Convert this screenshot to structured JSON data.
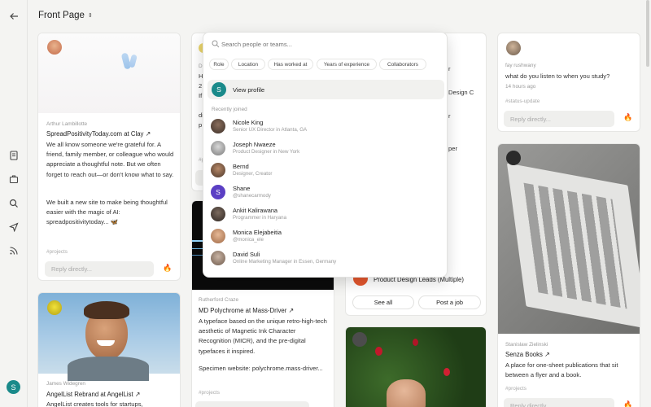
{
  "header": {
    "title": "Front Page",
    "switcher_glyph": "⇕"
  },
  "rail": {
    "icons": [
      "back-arrow-icon",
      "notebook-icon",
      "briefcase-icon",
      "search-icon",
      "send-icon",
      "rss-icon"
    ],
    "avatar_initial": "S"
  },
  "colors": {
    "teal": "#1a8a8a",
    "purple": "#5b3fc4",
    "orange": "#e4572e",
    "fire": "#e8751a"
  },
  "card1": {
    "author": "Arthur Lambillotte",
    "title": "SpreadPositivityToday.com at Clay ↗",
    "body1": "We all know someone we're grateful for. A friend, family member, or colleague who would appreciate a thoughtful note. But we often forget to reach out—or don't know what to say.",
    "body2": "We built a new site to make being thoughtful easier with the magic of AI: spreadpositivitytoday... 🦋",
    "tag": "#projects",
    "reply": "Reply directly...",
    "fire": "🔥"
  },
  "card2": {
    "author": "James Widegren",
    "title": "AngelList Rebrand at AngelList ↗",
    "body": "AngelList creates tools for startups,"
  },
  "card3": {
    "top_lines": [
      "Di",
      "H",
      "2",
      "If",
      "di",
      "p"
    ],
    "tag_stub": "#p",
    "author": "Rutherford Craze",
    "title": "MD Polychrome at Mass-Driver ↗",
    "body1": "A typeface based on the unique retro-high-tech aesthetic of Magnetic Ink Character Recognition (MICR), and the pre-digital typefaces it inspired.",
    "body2": "Specimen website: polychrome.mass-driver...",
    "tag": "#projects"
  },
  "card4": {
    "right_lines": [
      "r",
      "Design C",
      "r",
      "per"
    ],
    "job_label": "Product Design Leads (Multiple)",
    "see_all": "See all",
    "post_job": "Post a job"
  },
  "card5": {
    "author": "fay rushwany",
    "question": "what do you listen to when you study?",
    "time": "14 hours ago",
    "tag": "#status-update",
    "reply": "Reply directly...",
    "fire": "🔥"
  },
  "card6": {
    "author": "Stanislaw Zielinski",
    "title": "Senza Books ↗",
    "body": "A place for one-sheet publications that sit between a flyer and a book.",
    "tag": "#projects",
    "reply": "Reply directly...",
    "fire": "🔥"
  },
  "dropdown": {
    "search_placeholder": "Search people or teams...",
    "filters": [
      "Role",
      "Location",
      "Has worked at",
      "Years of experience",
      "Collaborators"
    ],
    "view_profile": "View profile",
    "view_profile_initial": "S",
    "recent_label": "Recently joined",
    "people": [
      {
        "name": "Nicole King",
        "role": "Senior UX Director in Atlanta, GA"
      },
      {
        "name": "Joseph Nwaeze",
        "role": "Product Designer in New York"
      },
      {
        "name": "Bernd",
        "role": "Designer, Creator"
      },
      {
        "name": "Shane",
        "role": "@shanecarmody",
        "initial": "S"
      },
      {
        "name": "Ankit Kalirawana",
        "role": "Programmer in Haryana"
      },
      {
        "name": "Monica Elejabeitia",
        "role": "@monica_ele"
      },
      {
        "name": "David Suli",
        "role": "Online Marketing Manager in Essen, Germany"
      }
    ]
  }
}
